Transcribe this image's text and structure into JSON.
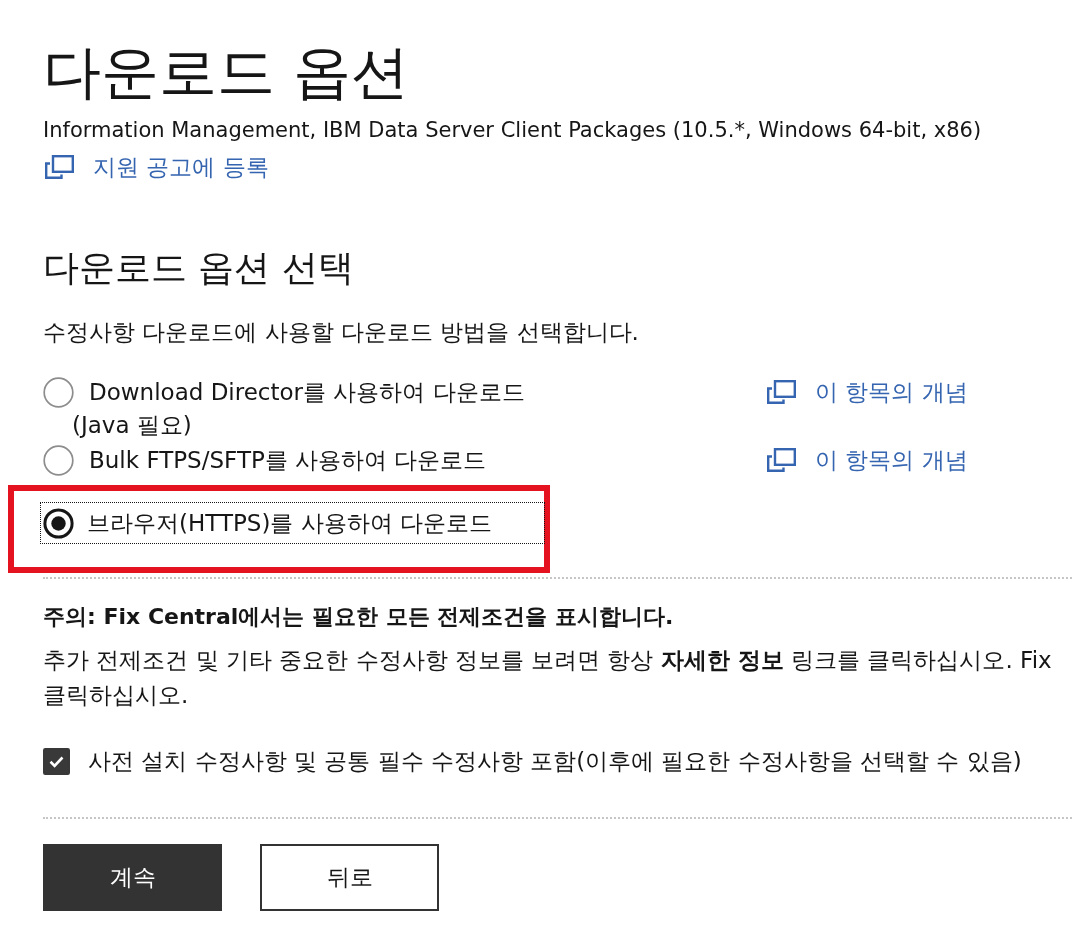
{
  "title": "다운로드 옵션",
  "subtitle": "Information Management, IBM Data Server Client Packages (10.5.*, Windows 64-bit, x86)",
  "subscribe_link": "지원 공고에 등록",
  "section": {
    "heading": "다운로드 옵션 선택",
    "description": "수정사항 다운로드에 사용할 다운로드 방법을 선택합니다."
  },
  "download_options": [
    {
      "label": "Download Director를 사용하여 다운로드",
      "note": "(Java 필요)",
      "link": "이 항목의 개념",
      "selected": false,
      "focused": false,
      "highlighted": false
    },
    {
      "label": "Bulk FTPS/SFTP를 사용하여 다운로드",
      "link": "이 항목의 개념",
      "selected": false,
      "focused": false,
      "highlighted": false
    },
    {
      "label": "브라우저(HTTPS)를 사용하여 다운로드",
      "selected": true,
      "focused": true,
      "highlighted": true
    }
  ],
  "notice": {
    "heading": "주의: Fix Central에서는 필요한 모든 전제조건을 표시합니다.",
    "lines": [
      "추가 전제조건 및 기타 중요한 수정사항 정보를 보려면 항상 **자세한 정보** 링크를 클릭하십시오. Fix",
      "클릭하십시오."
    ]
  },
  "include_prerequisites": {
    "label": "사전 설치 수정사항 및 공통 필수 수정사항 포함(이후에 필요한 수정사항을 선택할 수 있음)",
    "checked": true
  },
  "buttons": [
    {
      "label": "계속",
      "kind": "primary"
    },
    {
      "label": "뒤로",
      "kind": "secondary"
    }
  ]
}
